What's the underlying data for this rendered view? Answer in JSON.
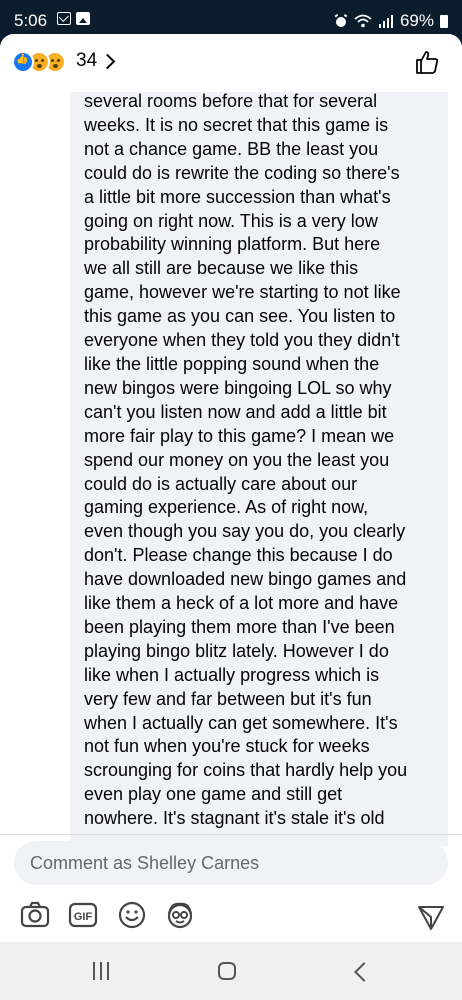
{
  "status_bar": {
    "time": "5:06",
    "battery": "69%",
    "left_icons": [
      "gmail-icon",
      "photo-icon"
    ],
    "right_icons": [
      "alarm-icon",
      "wifi-icon",
      "signal-icon",
      "battery-icon"
    ]
  },
  "reactions": {
    "icons": [
      "like-reaction-icon",
      "sad-reaction-icon",
      "wow-reaction-icon"
    ],
    "count": "34",
    "chevron": "chevron-right-icon",
    "like_button_icon": "thumbs-up-icon"
  },
  "comment": {
    "text": "several rooms before that for several\nweeks. It is no secret that this game is\nnot a chance game. BB the least you\ncould do is rewrite the coding so there's\na little bit more succession than what's\ngoing on right now. This is a very low\nprobability winning platform. But here\nwe all still are because we like this\ngame, however we're starting to not like\nthis game as you can see. You listen to\neveryone when they told you they didn't\nlike the little popping sound when the\nnew bingos were bingoing LOL so why\ncan't you listen now and add a little bit\nmore fair play to this game? I mean we\nspend our money on you the least you\ncould do is actually care about our\ngaming experience. As of right now,\neven though you say you do, you clearly\ndon't. Please change this because I do\nhave downloaded new bingo games and\nlike them a heck of a lot more and have\nbeen playing them more than I've been\nplaying bingo blitz lately. However I do\nlike when I actually progress which is\nvery few and far between but it's fun\nwhen I actually can get somewhere. It's\nnot fun when you're stuck for weeks\nscrounging for coins that hardly help you\neven play one game and still get\nnowhere. It's stagnant it's stale it's old"
  },
  "composer": {
    "placeholder": "Comment as Shelley Carnes",
    "tools": [
      "camera-icon",
      "gif-icon",
      "emoji-icon",
      "avatar-sticker-icon"
    ],
    "gif_label": "GIF",
    "send_icon": "send-icon"
  },
  "nav_bar": {
    "buttons": [
      "recents-icon",
      "home-icon",
      "back-icon"
    ]
  },
  "colors": {
    "status_bar_bg": "#0b1c2c",
    "comment_bubble_bg": "#f0f2f5",
    "like_blue": "#1877f2",
    "reaction_yellow": "#f7b125",
    "placeholder_gray": "#65676b"
  }
}
